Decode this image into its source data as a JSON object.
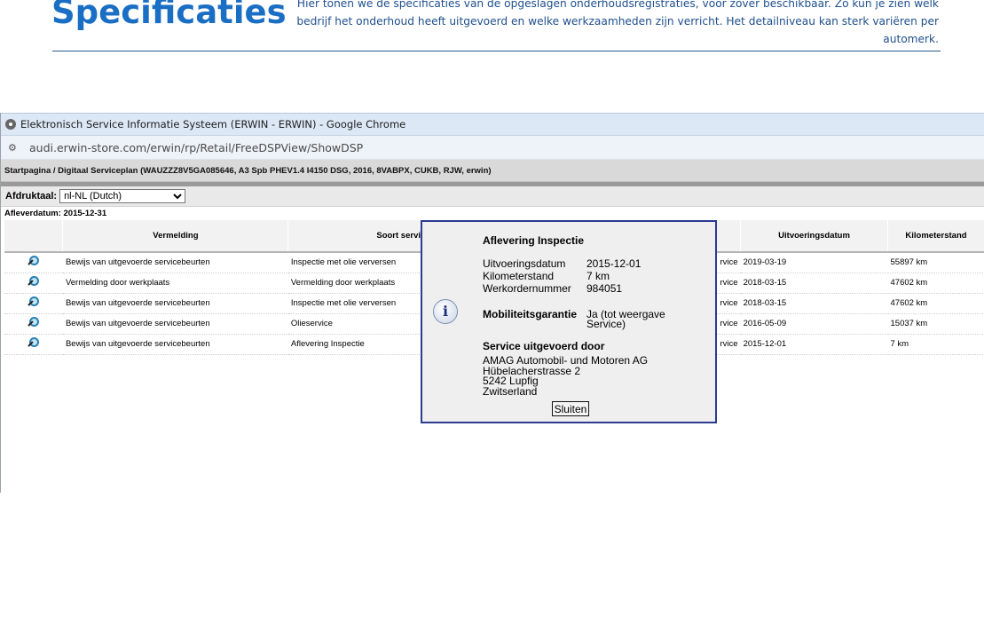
{
  "article": {
    "heading": "Specificaties",
    "intro": "Hier tonen we de specificaties van de opgeslagen onderhoudsregistraties, voor zover beschikbaar. Zo kun je zien welk bedrijf het onderhoud heeft uitgevoerd en welke werkzaamheden zijn verricht. Het detailniveau kan sterk variëren per automerk."
  },
  "browser": {
    "window_title": "Elektronisch Service Informatie Systeem (ERWIN - ERWIN) - Google Chrome",
    "url": "audi.erwin-store.com/erwin/rp/Retail/FreeDSPView/ShowDSP",
    "breadcrumb": "Startpagina / Digitaal Serviceplan (WAUZZZ8V5GA085646, A3 Spb PHEV1.4 I4150 DSG, 2016, 8VABPX, CUKB, RJW, erwin)",
    "print_language_label": "Afdruktaal:",
    "print_language_value": "nl-NL (Dutch)",
    "delivery_date": "Afleverdatum: 2015-12-31"
  },
  "table": {
    "headers": [
      "",
      "Vermelding",
      "Soort servic",
      "",
      "Uitvoeringsdatum",
      "Kilometerstand"
    ],
    "rows": [
      {
        "vermelding": "Bewijs van uitgevoerde servicebeurten",
        "soort": "Inspectie met olie verversen",
        "partial": "rvice",
        "datum": "2019-03-19",
        "km": "55897 km"
      },
      {
        "vermelding": "Vermelding door werkplaats",
        "soort": "Vermelding door werkplaats",
        "partial": "rvice",
        "datum": "2018-03-15",
        "km": "47602 km"
      },
      {
        "vermelding": "Bewijs van uitgevoerde servicebeurten",
        "soort": "Inspectie met olie verversen",
        "partial": "rvice",
        "datum": "2018-03-15",
        "km": "47602 km"
      },
      {
        "vermelding": "Bewijs van uitgevoerde servicebeurten",
        "soort": "Olieservice",
        "partial": "rvice",
        "datum": "2016-05-09",
        "km": "15037 km"
      },
      {
        "vermelding": "Bewijs van uitgevoerde servicebeurten",
        "soort": "Aflevering Inspectie",
        "partial": "rvice",
        "datum": "2015-12-01",
        "km": "7 km"
      }
    ]
  },
  "modal": {
    "title": "Aflevering Inspectie",
    "uitvoeringsdatum_label": "Uitvoeringsdatum",
    "uitvoeringsdatum_value": "2015-12-01",
    "kilometerstand_label": "Kilometerstand",
    "kilometerstand_value": "7 km",
    "werkordernummer_label": "Werkordernummer",
    "werkordernummer_value": "984051",
    "mobiliteit_label": "Mobiliteitsgarantie",
    "mobiliteit_value_line1": "Ja (tot weergave",
    "mobiliteit_value_line2": "Service)",
    "service_title": "Service uitgevoerd door",
    "address": [
      "AMAG Automobil- und Motoren AG",
      "Hübelacherstrasse 2",
      "5242 Lupfig",
      "Zwitserland"
    ],
    "close_label": "Sluiten"
  }
}
